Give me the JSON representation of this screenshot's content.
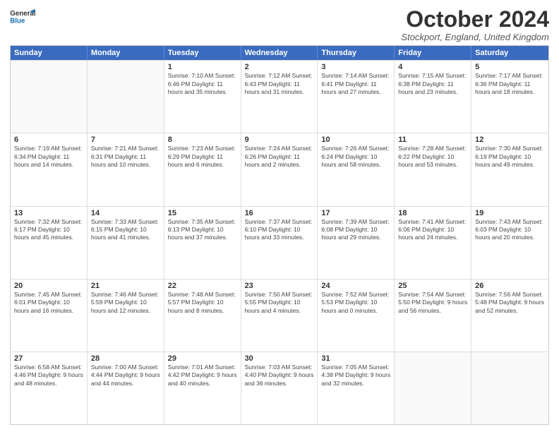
{
  "header": {
    "logo_general": "General",
    "logo_blue": "Blue",
    "month_title": "October 2024",
    "location": "Stockport, England, United Kingdom"
  },
  "days_of_week": [
    "Sunday",
    "Monday",
    "Tuesday",
    "Wednesday",
    "Thursday",
    "Friday",
    "Saturday"
  ],
  "weeks": [
    [
      {
        "day": "",
        "info": ""
      },
      {
        "day": "",
        "info": ""
      },
      {
        "day": "1",
        "info": "Sunrise: 7:10 AM\nSunset: 6:46 PM\nDaylight: 11 hours and 35 minutes."
      },
      {
        "day": "2",
        "info": "Sunrise: 7:12 AM\nSunset: 6:43 PM\nDaylight: 11 hours and 31 minutes."
      },
      {
        "day": "3",
        "info": "Sunrise: 7:14 AM\nSunset: 6:41 PM\nDaylight: 11 hours and 27 minutes."
      },
      {
        "day": "4",
        "info": "Sunrise: 7:15 AM\nSunset: 6:38 PM\nDaylight: 11 hours and 23 minutes."
      },
      {
        "day": "5",
        "info": "Sunrise: 7:17 AM\nSunset: 6:36 PM\nDaylight: 11 hours and 18 minutes."
      }
    ],
    [
      {
        "day": "6",
        "info": "Sunrise: 7:19 AM\nSunset: 6:34 PM\nDaylight: 11 hours and 14 minutes."
      },
      {
        "day": "7",
        "info": "Sunrise: 7:21 AM\nSunset: 6:31 PM\nDaylight: 11 hours and 10 minutes."
      },
      {
        "day": "8",
        "info": "Sunrise: 7:23 AM\nSunset: 6:29 PM\nDaylight: 11 hours and 6 minutes."
      },
      {
        "day": "9",
        "info": "Sunrise: 7:24 AM\nSunset: 6:26 PM\nDaylight: 11 hours and 2 minutes."
      },
      {
        "day": "10",
        "info": "Sunrise: 7:26 AM\nSunset: 6:24 PM\nDaylight: 10 hours and 58 minutes."
      },
      {
        "day": "11",
        "info": "Sunrise: 7:28 AM\nSunset: 6:22 PM\nDaylight: 10 hours and 53 minutes."
      },
      {
        "day": "12",
        "info": "Sunrise: 7:30 AM\nSunset: 6:19 PM\nDaylight: 10 hours and 49 minutes."
      }
    ],
    [
      {
        "day": "13",
        "info": "Sunrise: 7:32 AM\nSunset: 6:17 PM\nDaylight: 10 hours and 45 minutes."
      },
      {
        "day": "14",
        "info": "Sunrise: 7:33 AM\nSunset: 6:15 PM\nDaylight: 10 hours and 41 minutes."
      },
      {
        "day": "15",
        "info": "Sunrise: 7:35 AM\nSunset: 6:13 PM\nDaylight: 10 hours and 37 minutes."
      },
      {
        "day": "16",
        "info": "Sunrise: 7:37 AM\nSunset: 6:10 PM\nDaylight: 10 hours and 33 minutes."
      },
      {
        "day": "17",
        "info": "Sunrise: 7:39 AM\nSunset: 6:08 PM\nDaylight: 10 hours and 29 minutes."
      },
      {
        "day": "18",
        "info": "Sunrise: 7:41 AM\nSunset: 6:06 PM\nDaylight: 10 hours and 24 minutes."
      },
      {
        "day": "19",
        "info": "Sunrise: 7:43 AM\nSunset: 6:03 PM\nDaylight: 10 hours and 20 minutes."
      }
    ],
    [
      {
        "day": "20",
        "info": "Sunrise: 7:45 AM\nSunset: 6:01 PM\nDaylight: 10 hours and 16 minutes."
      },
      {
        "day": "21",
        "info": "Sunrise: 7:46 AM\nSunset: 5:59 PM\nDaylight: 10 hours and 12 minutes."
      },
      {
        "day": "22",
        "info": "Sunrise: 7:48 AM\nSunset: 5:57 PM\nDaylight: 10 hours and 8 minutes."
      },
      {
        "day": "23",
        "info": "Sunrise: 7:50 AM\nSunset: 5:55 PM\nDaylight: 10 hours and 4 minutes."
      },
      {
        "day": "24",
        "info": "Sunrise: 7:52 AM\nSunset: 5:53 PM\nDaylight: 10 hours and 0 minutes."
      },
      {
        "day": "25",
        "info": "Sunrise: 7:54 AM\nSunset: 5:50 PM\nDaylight: 9 hours and 56 minutes."
      },
      {
        "day": "26",
        "info": "Sunrise: 7:56 AM\nSunset: 5:48 PM\nDaylight: 9 hours and 52 minutes."
      }
    ],
    [
      {
        "day": "27",
        "info": "Sunrise: 6:58 AM\nSunset: 4:46 PM\nDaylight: 9 hours and 48 minutes."
      },
      {
        "day": "28",
        "info": "Sunrise: 7:00 AM\nSunset: 4:44 PM\nDaylight: 9 hours and 44 minutes."
      },
      {
        "day": "29",
        "info": "Sunrise: 7:01 AM\nSunset: 4:42 PM\nDaylight: 9 hours and 40 minutes."
      },
      {
        "day": "30",
        "info": "Sunrise: 7:03 AM\nSunset: 4:40 PM\nDaylight: 9 hours and 36 minutes."
      },
      {
        "day": "31",
        "info": "Sunrise: 7:05 AM\nSunset: 4:38 PM\nDaylight: 9 hours and 32 minutes."
      },
      {
        "day": "",
        "info": ""
      },
      {
        "day": "",
        "info": ""
      }
    ]
  ]
}
